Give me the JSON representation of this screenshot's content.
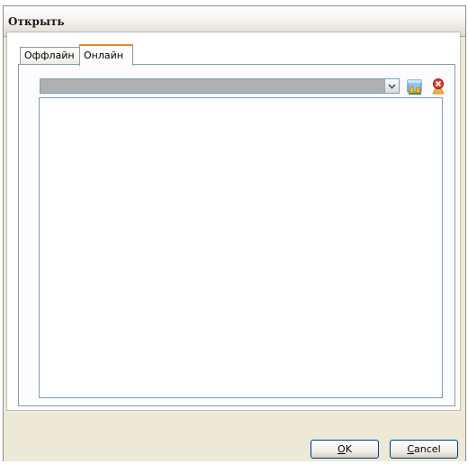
{
  "window": {
    "title": "Открыть"
  },
  "tabs": [
    {
      "label": "Оффлайн",
      "selected": false
    },
    {
      "label": "Онлайн",
      "selected": true
    }
  ],
  "address": {
    "value": ""
  },
  "icons": {
    "open_map": "map-open-icon",
    "delete_map": "delete-pin-icon"
  },
  "buttons": {
    "ok": "OK",
    "cancel": "Cancel"
  },
  "colors": {
    "tab_accent": "#e68b2c",
    "dialog_bg": "#ece9d8",
    "field_border": "#7f9db9"
  }
}
